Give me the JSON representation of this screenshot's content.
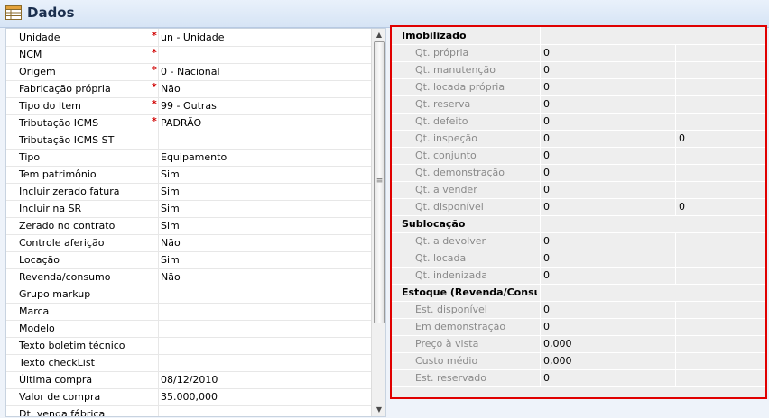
{
  "window": {
    "title": "Dados"
  },
  "left_fields": [
    {
      "label": "Unidade",
      "required": "*",
      "value": "un - Unidade"
    },
    {
      "label": "NCM",
      "required": "*",
      "value": ""
    },
    {
      "label": "Origem",
      "required": "*",
      "value": "0 - Nacional"
    },
    {
      "label": "Fabricação própria",
      "required": "*",
      "value": "Não"
    },
    {
      "label": "Tipo do Item",
      "required": "*",
      "value": "99 - Outras"
    },
    {
      "label": "Tributação ICMS",
      "required": "*",
      "value": "PADRÃO"
    },
    {
      "label": "Tributação ICMS ST",
      "value": ""
    },
    {
      "label": "Tipo",
      "value": "Equipamento"
    },
    {
      "label": "Tem patrimônio",
      "value": "Sim"
    },
    {
      "label": "Incluir zerado fatura",
      "value": "Sim"
    },
    {
      "label": "Incluir na SR",
      "value": "Sim"
    },
    {
      "label": "Zerado no contrato",
      "value": "Sim"
    },
    {
      "label": "Controle aferição",
      "value": "Não"
    },
    {
      "label": "Locação",
      "value": "Sim"
    },
    {
      "label": "Revenda/consumo",
      "value": "Não"
    },
    {
      "label": "Grupo markup",
      "value": ""
    },
    {
      "label": "Marca",
      "value": ""
    },
    {
      "label": "Modelo",
      "value": ""
    },
    {
      "label": "Texto boletim técnico",
      "value": ""
    },
    {
      "label": "Texto checkList",
      "value": ""
    },
    {
      "label": "Última compra",
      "value": "08/12/2010"
    },
    {
      "label": "Valor de compra",
      "value": "35.000,000"
    },
    {
      "label": "Dt. venda fábrica",
      "value": ""
    }
  ],
  "right_rows": [
    {
      "section": "Imobilizado"
    },
    {
      "label": "Qt. própria",
      "v1": "0"
    },
    {
      "label": "Qt. manutenção",
      "v1": "0"
    },
    {
      "label": "Qt. locada própria",
      "v1": "0"
    },
    {
      "label": "Qt. reserva",
      "v1": "0"
    },
    {
      "label": "Qt. defeito",
      "v1": "0"
    },
    {
      "label": "Qt. inspeção",
      "v1": "0",
      "v2": "0"
    },
    {
      "label": "Qt. conjunto",
      "v1": "0"
    },
    {
      "label": "Qt. demonstração",
      "v1": "0"
    },
    {
      "label": "Qt. a vender",
      "v1": "0"
    },
    {
      "label": "Qt. disponível",
      "v1": "0",
      "v2": "0"
    },
    {
      "section": "Sublocação"
    },
    {
      "label": "Qt. a devolver",
      "v1": "0"
    },
    {
      "label": "Qt. locada",
      "v1": "0"
    },
    {
      "label": "Qt. indenizada",
      "v1": "0"
    },
    {
      "section": "Estoque (Revenda/Consum"
    },
    {
      "label": "Est. disponível",
      "v1": "0"
    },
    {
      "label": "Em demonstração",
      "v1": "0"
    },
    {
      "label": "Preço à vista",
      "v1": "0,000"
    },
    {
      "label": "Custo médio",
      "v1": "0,000"
    },
    {
      "label": "Est. reservado",
      "v1": "0"
    }
  ],
  "scrollbar": {
    "up_glyph": "▲",
    "down_glyph": "▼",
    "grip_glyph": "≡"
  },
  "colors": {
    "required": "#d00000",
    "highlight_border": "#e00000",
    "muted_label": "#8a8a8a"
  }
}
